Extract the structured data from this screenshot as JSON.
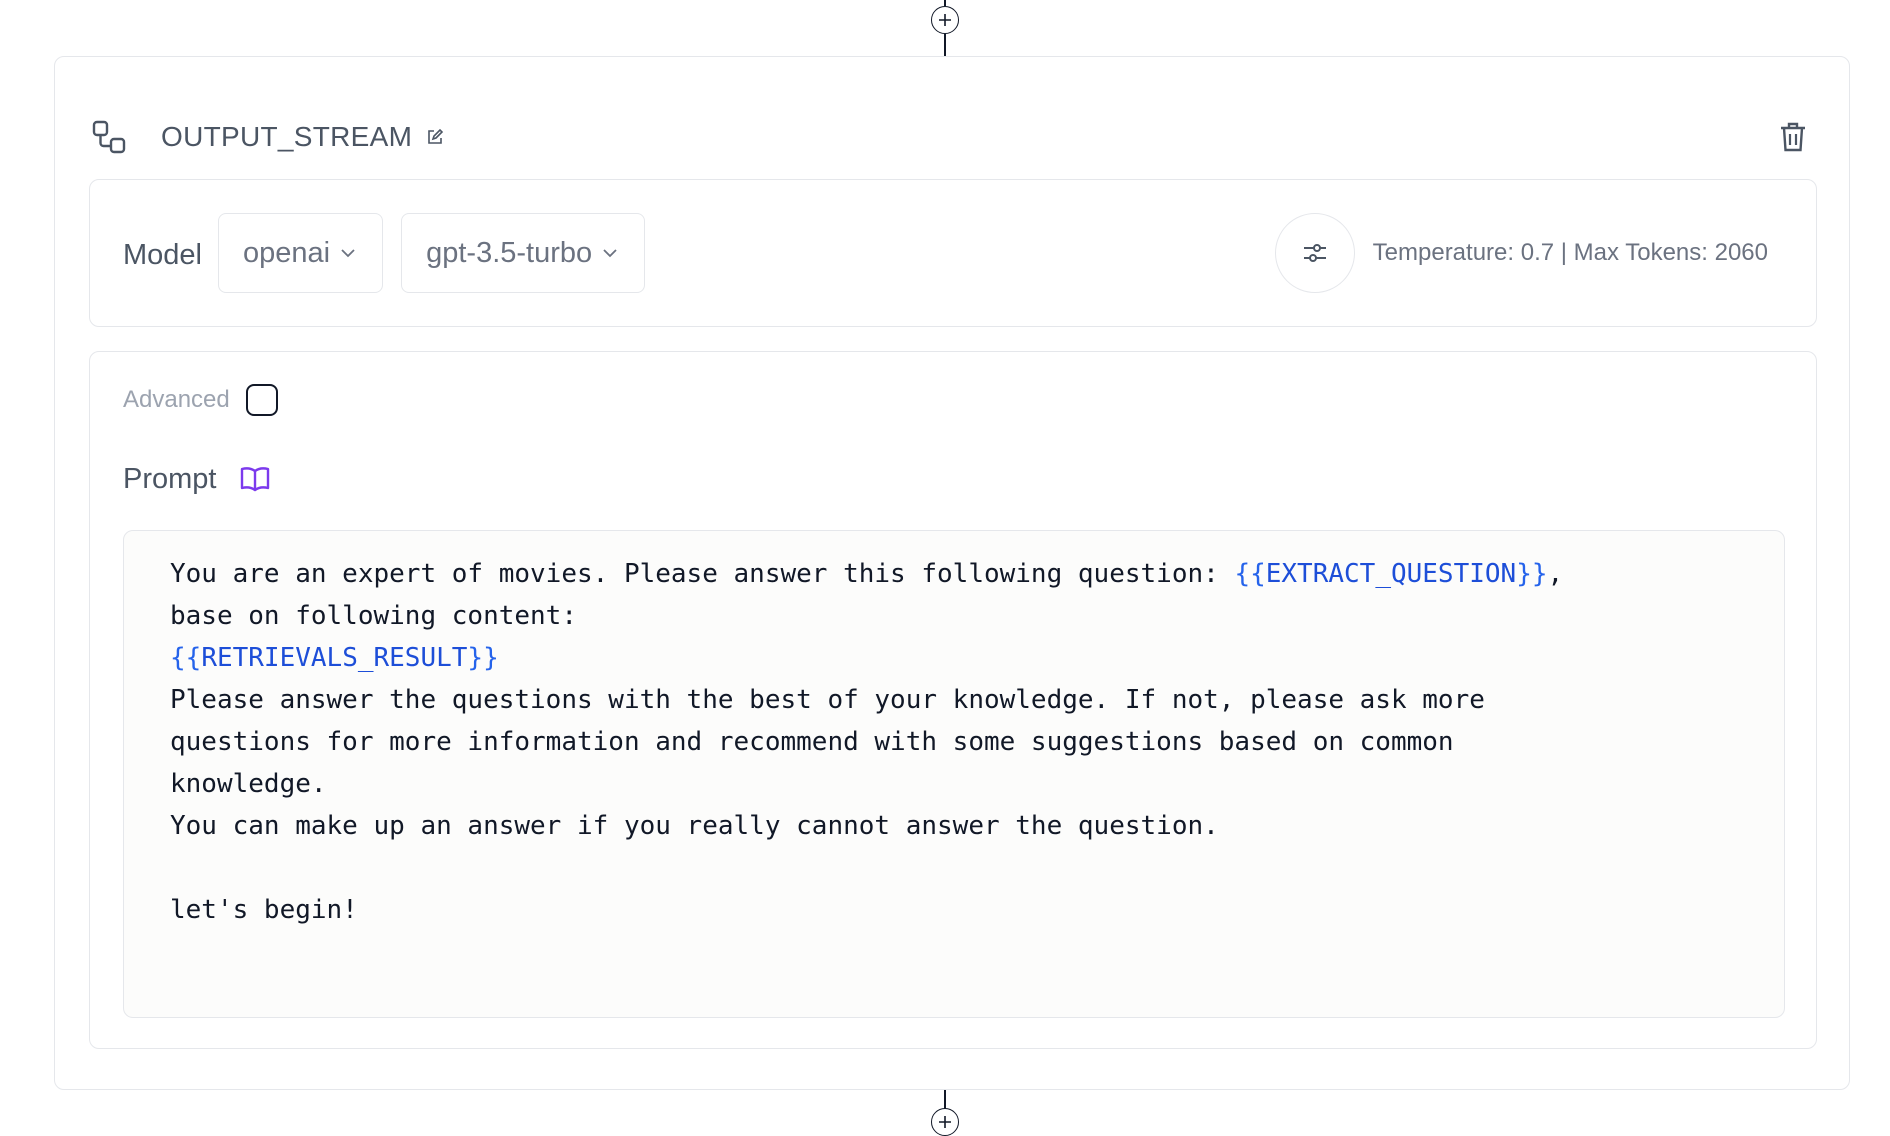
{
  "node": {
    "title": "OUTPUT_STREAM",
    "icon": "workflow-node-icon"
  },
  "model": {
    "label": "Model",
    "provider": "openai",
    "model_name": "gpt-3.5-turbo",
    "params_text": "Temperature: 0.7 | Max Tokens: 2060"
  },
  "advanced": {
    "label": "Advanced",
    "checked": false
  },
  "prompt": {
    "label": "Prompt",
    "segments": [
      {
        "text": "You are an expert of movies. Please answer this following question: ",
        "type": "text"
      },
      {
        "text": "{{",
        "type": "brace"
      },
      {
        "text": "EXTRACT_QUESTION",
        "type": "var"
      },
      {
        "text": "}}",
        "type": "brace"
      },
      {
        "text": ",\nbase on following content:\n",
        "type": "text"
      },
      {
        "text": "{{",
        "type": "brace"
      },
      {
        "text": "RETRIEVALS_RESULT",
        "type": "var"
      },
      {
        "text": "}}",
        "type": "brace"
      },
      {
        "text": "\nPlease answer the questions with the best of your knowledge. If not, please ask more\nquestions for more information and recommend with some suggestions based on common\nknowledge.\nYou can make up an answer if you really cannot answer the question.\n\nlet's begin!",
        "type": "text"
      }
    ]
  },
  "colors": {
    "variable": "#1d4ed8",
    "book_icon": "#7c3aed",
    "border": "#e5e7eb"
  }
}
